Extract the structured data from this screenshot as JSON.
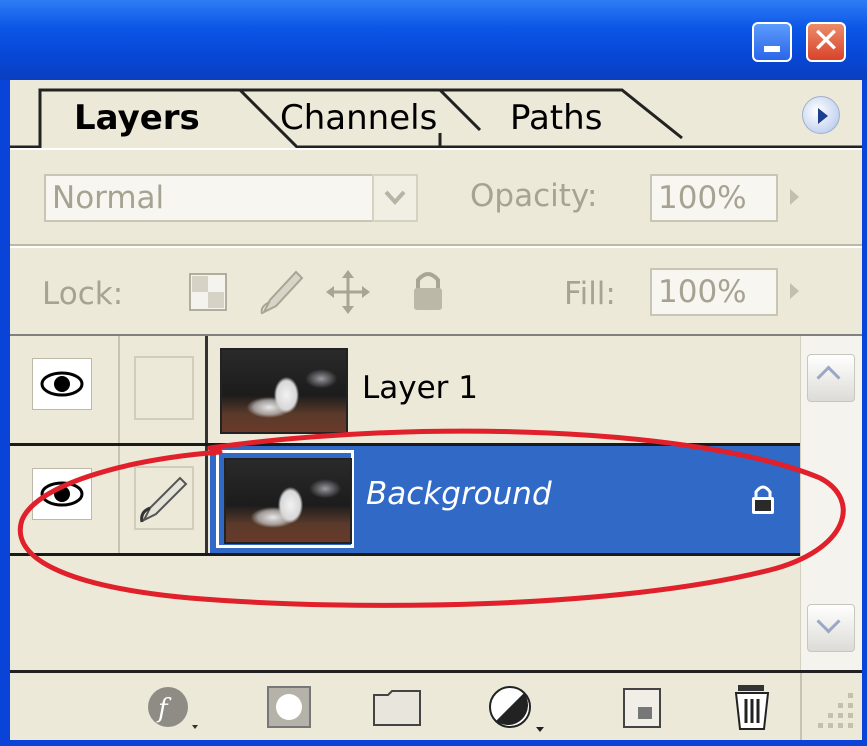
{
  "window": {
    "close_glyph": "✕"
  },
  "tabs": [
    {
      "label": "Layers",
      "active": true
    },
    {
      "label": "Channels",
      "active": false
    },
    {
      "label": "Paths",
      "active": false
    }
  ],
  "blend": {
    "mode_value": "Normal",
    "opacity_label": "Opacity:",
    "opacity_value": "100%"
  },
  "lock": {
    "label": "Lock:",
    "fill_label": "Fill:",
    "fill_value": "100%"
  },
  "layers": [
    {
      "name": "Layer 1",
      "visible": true,
      "selected": false,
      "locked": false
    },
    {
      "name": "Background",
      "visible": true,
      "selected": true,
      "locked": true
    }
  ],
  "colors": {
    "selection": "#3169c6",
    "panel": "#ece9d8",
    "annotation": "#e0202a"
  },
  "bottom_icons": [
    "layer-style-icon",
    "layer-mask-icon",
    "new-group-icon",
    "adjustment-layer-icon",
    "new-layer-icon",
    "delete-layer-icon"
  ]
}
